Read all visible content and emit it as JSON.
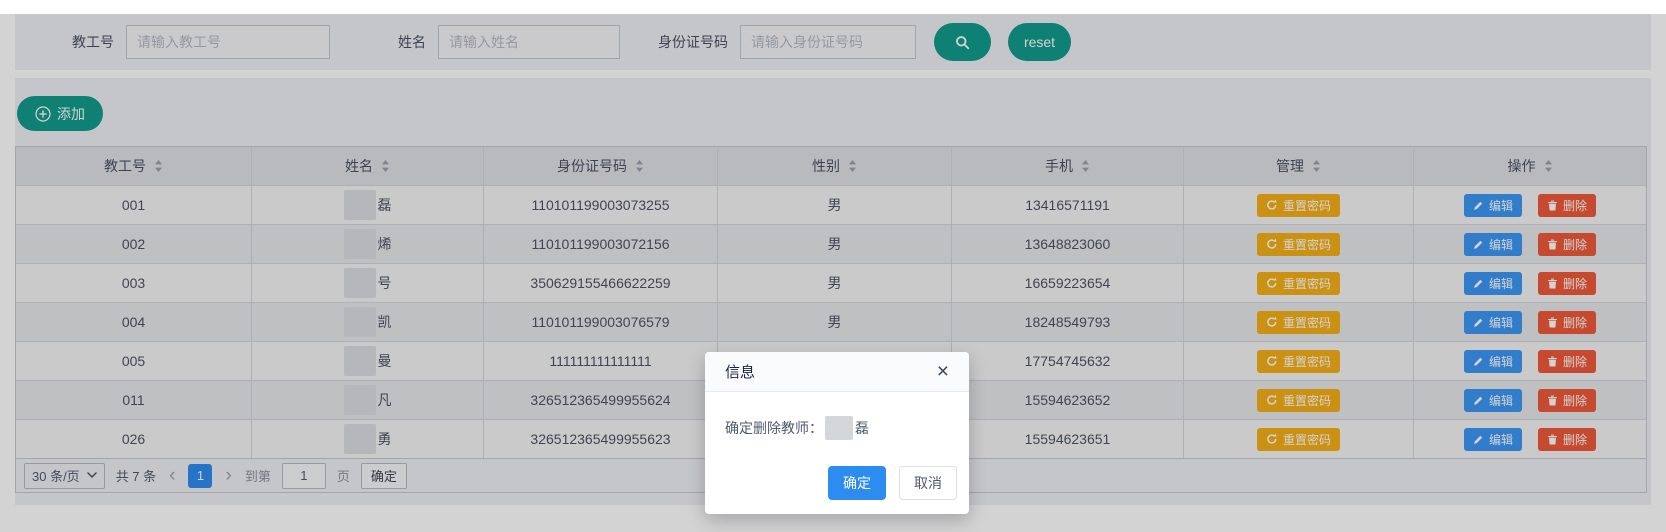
{
  "search": {
    "fields": [
      {
        "label": "教工号",
        "placeholder": "请输入教工号"
      },
      {
        "label": "姓名",
        "placeholder": "请输入姓名"
      },
      {
        "label": "身份证号码",
        "placeholder": "请输入身份证号码"
      }
    ],
    "reset_label": "reset"
  },
  "toolbar": {
    "add_label": "添加"
  },
  "table": {
    "columns": [
      "教工号",
      "姓名",
      "身份证号码",
      "性别",
      "手机",
      "管理",
      "操作"
    ],
    "action_labels": {
      "reset_password": "重置密码",
      "edit": "编辑",
      "delete": "删除"
    },
    "rows": [
      {
        "staff_id": "001",
        "name_masked": true,
        "name_visible_char": "磊",
        "id_card": "110101199003073255",
        "gender": "男",
        "phone": "13416571191"
      },
      {
        "staff_id": "002",
        "name_masked": true,
        "name_visible_char": "烯",
        "id_card": "110101199003072156",
        "gender": "男",
        "phone": "13648823060"
      },
      {
        "staff_id": "003",
        "name_masked": true,
        "name_visible_char": "号",
        "id_card": "350629155466622259",
        "gender": "男",
        "phone": "16659223654"
      },
      {
        "staff_id": "004",
        "name_masked": true,
        "name_visible_char": "凯",
        "id_card": "110101199003076579",
        "gender": "男",
        "phone": "18248549793"
      },
      {
        "staff_id": "005",
        "name_masked": true,
        "name_visible_char": "曼",
        "id_card": "111111111111111",
        "gender": "",
        "phone": "17754745632"
      },
      {
        "staff_id": "011",
        "name_masked": true,
        "name_visible_char": "凡",
        "id_card": "326512365499955624",
        "gender": "",
        "phone": "15594623652"
      },
      {
        "staff_id": "026",
        "name_masked": true,
        "name_visible_char": "勇",
        "id_card": "326512365499955623",
        "gender": "",
        "phone": "15594623651"
      }
    ]
  },
  "pagination": {
    "page_size_label": "30 条/页",
    "total_label": "共 7 条",
    "current_page": "1",
    "goto_prefix": "到第",
    "goto_value": "1",
    "goto_suffix": "页",
    "confirm_label": "确定"
  },
  "modal": {
    "title": "信息",
    "message_prefix": "确定删除教师：",
    "teacher_name_visible_char": "磊",
    "confirm_label": "确定",
    "cancel_label": "取消"
  },
  "colors": {
    "teal": "#119a8a",
    "primary_blue": "#2d8cf0",
    "edit_blue": "#3b97f2",
    "delete_red": "#ef5837",
    "warning_orange": "#f5af14"
  }
}
